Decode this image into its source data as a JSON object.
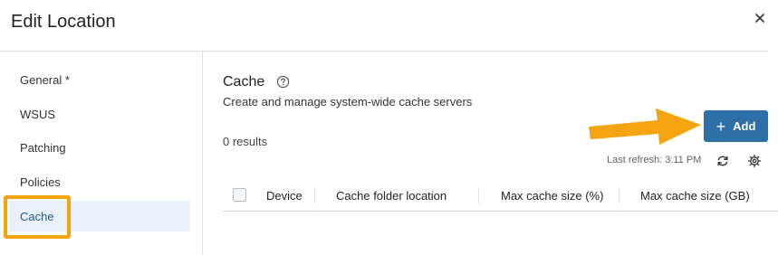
{
  "dialog": {
    "title": "Edit Location"
  },
  "sidebar": {
    "items": [
      {
        "label": "General *"
      },
      {
        "label": "WSUS"
      },
      {
        "label": "Patching"
      },
      {
        "label": "Policies"
      },
      {
        "label": "Cache"
      }
    ],
    "active": "Cache"
  },
  "main": {
    "title": "Cache",
    "description": "Create and manage system-wide cache servers",
    "results": "0 results",
    "add_label": "Add",
    "last_refresh": "Last refresh: 3:11 PM"
  },
  "table": {
    "columns": [
      "Device",
      "Cache folder location",
      "Max cache size (%)",
      "Max cache size (GB)"
    ]
  },
  "icons": {
    "close": "close-icon",
    "help": "help-icon",
    "plus": "plus-icon",
    "refresh": "refresh-icon",
    "settings": "gear-icon"
  },
  "colors": {
    "primary": "#2d6fa8",
    "active_bg": "#eaf1f8",
    "active_text": "#1f5a8c",
    "annotation": "#f3a40f"
  }
}
